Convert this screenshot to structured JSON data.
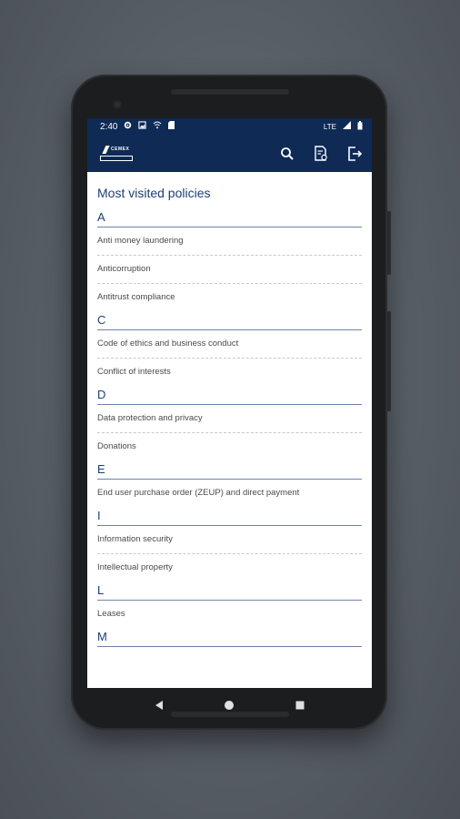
{
  "status": {
    "time": "2:40",
    "network": "LTE",
    "icons_left": [
      "settings-icon",
      "photo-icon",
      "wifi-icon",
      "sim-icon"
    ],
    "icons_right": [
      "signal-icon",
      "battery-icon"
    ]
  },
  "appbar": {
    "logo_word": "CEMEX",
    "actions": [
      "search-icon",
      "document-icon",
      "logout-icon"
    ]
  },
  "main": {
    "section_title": "Most visited policies",
    "groups": [
      {
        "letter": "A",
        "items": [
          "Anti money laundering",
          "Anticorruption",
          "Antitrust compliance"
        ]
      },
      {
        "letter": "C",
        "items": [
          "Code of ethics and business conduct",
          "Conflict of interests"
        ]
      },
      {
        "letter": "D",
        "items": [
          "Data protection and privacy",
          "Donations"
        ]
      },
      {
        "letter": "E",
        "items": [
          "End user purchase order (ZEUP) and direct payment"
        ]
      },
      {
        "letter": "I",
        "items": [
          "Information security",
          "Intellectual property"
        ]
      },
      {
        "letter": "L",
        "items": [
          "Leases"
        ]
      },
      {
        "letter": "M",
        "items": []
      }
    ]
  },
  "colors": {
    "primary": "#0e2a55",
    "heading": "#1c3f73",
    "divider": "#6c84a8"
  }
}
